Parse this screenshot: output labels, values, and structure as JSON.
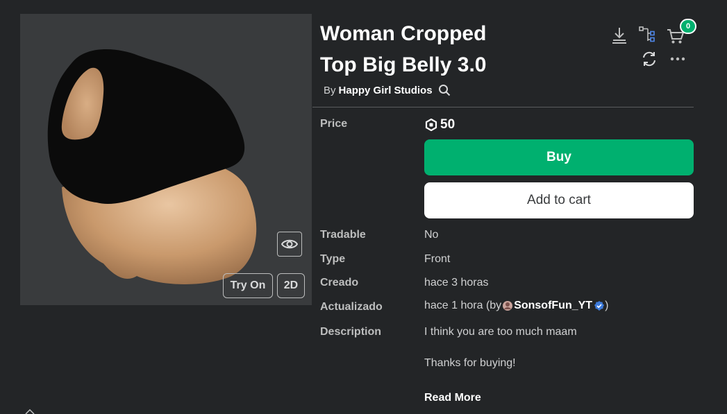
{
  "item": {
    "title": "Woman Cropped Top Big Belly 3.0",
    "by_label": "By",
    "creator": "Happy Girl Studios"
  },
  "preview": {
    "try_on": "Try On",
    "view_2d": "2D"
  },
  "cart": {
    "count": "0"
  },
  "details": {
    "price_label": "Price",
    "price_value": "50",
    "buy_label": "Buy",
    "add_to_cart_label": "Add to cart",
    "tradable_label": "Tradable",
    "tradable_value": "No",
    "type_label": "Type",
    "type_value": "Front",
    "created_label": "Creado",
    "created_value": "hace 3 horas",
    "updated_label": "Actualizado",
    "updated_prefix": "hace 1 hora (by ",
    "updated_user": "SonsofFun_YT",
    "updated_suffix": ")",
    "description_label": "Description",
    "description_line1": "I think you are too much maam",
    "description_line2": "Thanks for buying!",
    "read_more": "Read More"
  },
  "colors": {
    "background": "#232527",
    "preview_bg": "#393b3d",
    "buy_green": "#00b06f",
    "verified_blue": "#3d7bdb"
  },
  "icons": [
    "download-icon",
    "hierarchy-icon",
    "cart-icon",
    "refresh-icon",
    "more-icon",
    "eye-icon",
    "search-icon",
    "robux-icon",
    "verified-badge-icon"
  ]
}
